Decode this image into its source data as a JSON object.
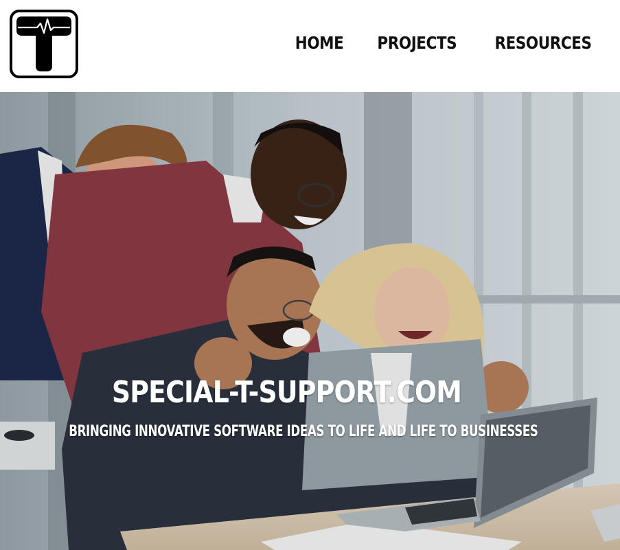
{
  "header": {
    "nav": [
      {
        "label": "HOME"
      },
      {
        "label": "PROJECTS"
      },
      {
        "label": "RESOURCES"
      }
    ]
  },
  "hero": {
    "title": "SPECIAL-T-SUPPORT.COM",
    "subtitle": "BRINGING INNOVATIVE SOFTWARE IDEAS TO LIFE AND LIFE TO BUSINESSES"
  },
  "icons": {
    "logo": "t-heartbeat-logo",
    "hero_image": "team-celebrating-photo"
  }
}
